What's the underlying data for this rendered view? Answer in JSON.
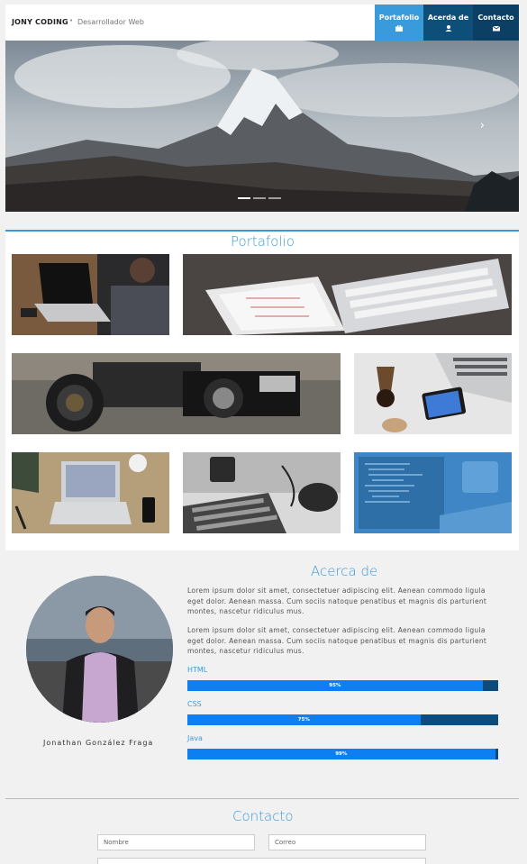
{
  "header": {
    "brand": "JONY CODING",
    "separator": "•",
    "subtitle": "Desarrollador Web"
  },
  "nav": [
    {
      "label": "Portafolio",
      "icon": "briefcase-icon"
    },
    {
      "label": "Acerda de",
      "icon": "user-icon"
    },
    {
      "label": "Contacto",
      "icon": "envelope-icon"
    }
  ],
  "hero": {
    "next_arrow": "›"
  },
  "portfolio": {
    "title": "Portafolio"
  },
  "about": {
    "title": "Acerca de",
    "name": "Jonathan González Fraga",
    "paragraphs": [
      "Lorem ipsum dolor sit amet, consectetuer adipiscing elit. Aenean commodo ligula eget dolor. Aenean massa. Cum sociis natoque penatibus et magnis dis parturient montes, nascetur ridiculus mus.",
      "Lorem ipsum dolor sit amet, consectetuer adipiscing elit. Aenean commodo ligula eget dolor. Aenean massa. Cum sociis natoque penatibus et magnis dis parturient montes, nascetur ridiculus mus."
    ],
    "skills": [
      {
        "name": "HTML",
        "percent_label": "95%",
        "value": 95
      },
      {
        "name": "CSS",
        "percent_label": "75%",
        "value": 75
      },
      {
        "name": "Java",
        "percent_label": "99%",
        "value": 99
      }
    ]
  },
  "contact": {
    "title": "Contacto",
    "name_placeholder": "Nombre",
    "email_placeholder": "Correo"
  },
  "colors": {
    "accent": "#3a9bdc",
    "nav_dark": "#0b3f63",
    "bar_fill": "#0d7ff2",
    "bar_track": "#0b4c7c"
  }
}
